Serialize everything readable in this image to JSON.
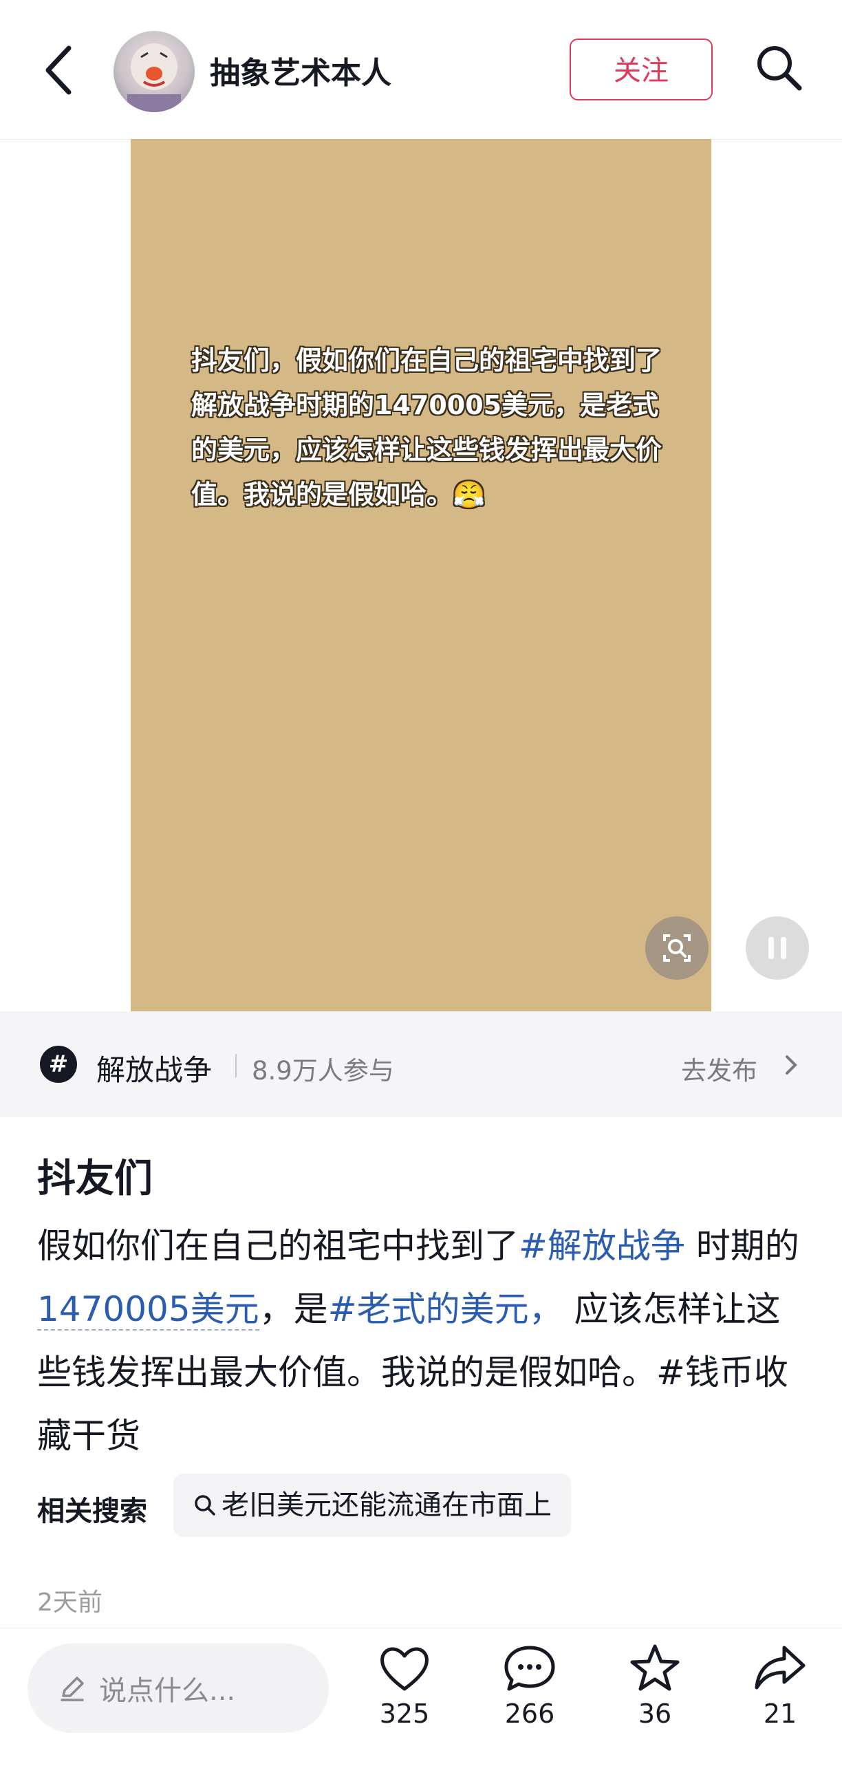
{
  "header": {
    "author_name": "抽象艺术本人",
    "follow_label": "关注"
  },
  "media": {
    "caption": "抖友们，假如你们在自己的祖宅中找到了解放战争时期的1470005美元，是老式的美元，应该怎样让这些钱发挥出最大价值。我说的是假如哈。😤"
  },
  "topic": {
    "icon": "#",
    "name": "解放战争",
    "participants": "8.9万人参与",
    "publish_label": "去发布"
  },
  "post": {
    "title": "抖友们",
    "body_1": "假如你们在自己的祖宅中找到了",
    "tag_1": "#解放战争",
    "body_2": " 时期的",
    "link_1": "1470005美元",
    "body_3": "，是",
    "tag_2": "#老式的美元，",
    "body_4": " 应该怎样让这些钱发挥出最大价值。我说的是假如哈。#钱币收藏干货"
  },
  "related": {
    "label": "相关搜索",
    "query": "老旧美元还能流通在市面上"
  },
  "meta": {
    "time": "2天前"
  },
  "bottom_bar": {
    "comment_placeholder": "说点什么...",
    "likes": "325",
    "comments": "266",
    "favorites": "36",
    "shares": "21"
  },
  "colors": {
    "accent": "#e03a5a",
    "link": "#2a5db0",
    "media_bg": "#d4b986"
  }
}
